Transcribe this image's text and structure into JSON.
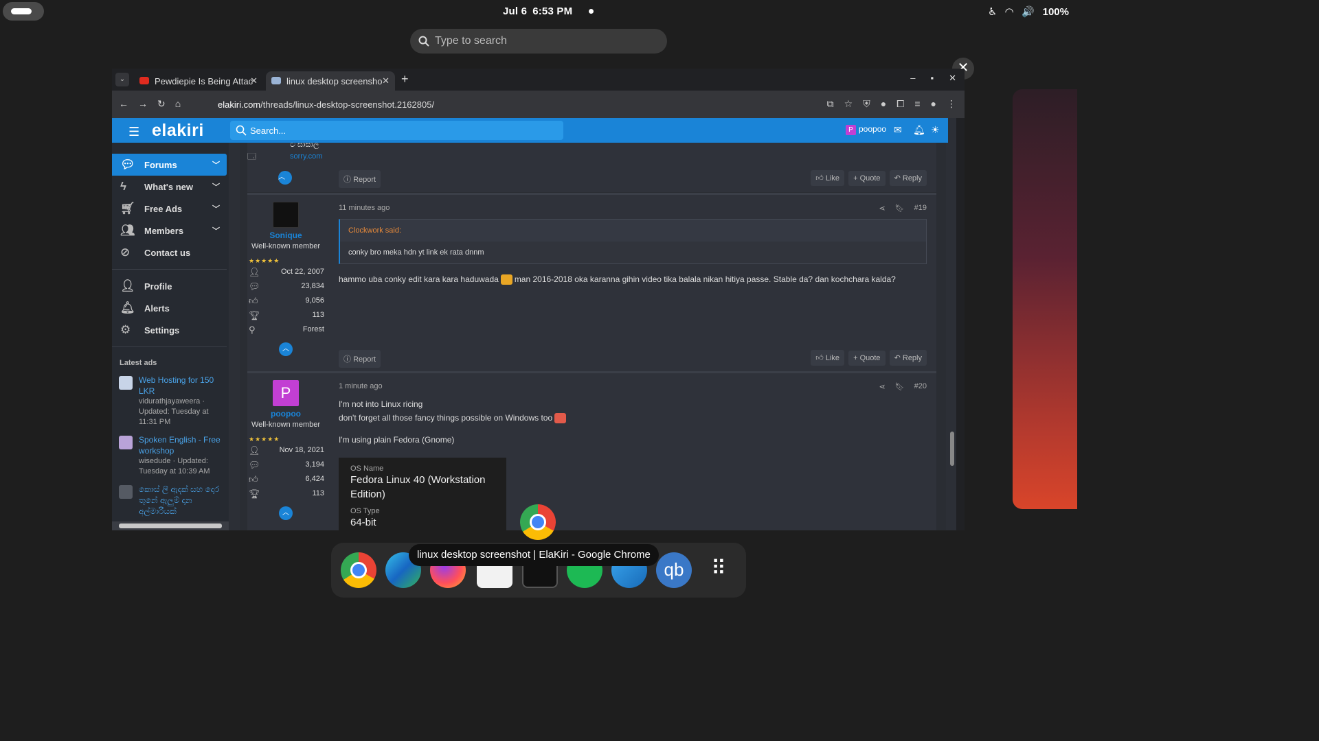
{
  "topbar": {
    "date": "Jul 6",
    "time": "6:53 PM",
    "battery": "100%"
  },
  "gnome_search": {
    "placeholder": "Type to search"
  },
  "browser": {
    "tabs": [
      {
        "label": "Pewdiepie Is Being Attac"
      },
      {
        "label": "linux desktop screensho"
      }
    ],
    "url_domain": "elakiri.com",
    "url_path": "/threads/linux-desktop-screenshot.2162805/"
  },
  "site": {
    "logo": "elakiri",
    "search_placeholder": "Search...",
    "username": "poopoo",
    "user_initial": "P",
    "nav": [
      {
        "label": "Forums"
      },
      {
        "label": "What's new"
      },
      {
        "label": "Free Ads"
      },
      {
        "label": "Members"
      },
      {
        "label": "Contact us"
      }
    ],
    "account": [
      {
        "label": "Profile"
      },
      {
        "label": "Alerts"
      },
      {
        "label": "Settings"
      }
    ],
    "latest_ads_heading": "Latest ads",
    "ads": [
      {
        "title": "Web Hosting for 150 LKR",
        "meta": "vidurathjayaweera · Updated: Tuesday at 11:31 PM"
      },
      {
        "title": "Spoken English - Free workshop",
        "meta": "wisedude · Updated: Tuesday at 10:39 AM"
      },
      {
        "title": "කොස් ලී ඇදක් සහ දොර තුනේ ඇලුම් දාන අල්මාරියක්",
        "meta": ""
      }
    ]
  },
  "prev_post": {
    "location_partial": "ට ඝාසාල",
    "website": "sorry.com",
    "report": "Report",
    "like": "Like",
    "quote": "Quote",
    "reply": "Reply"
  },
  "posts": [
    {
      "username": "Sonique",
      "title": "Well-known member",
      "stars": "★★★★★",
      "joined": "Oct 22, 2007",
      "messages": "23,834",
      "reactions": "9,056",
      "points": "113",
      "location": "Forest",
      "time": "11 minutes ago",
      "number": "#19",
      "quote_author": "Clockwork said:",
      "quote_text": "conky bro meka hdn yt link ek rata dnnm",
      "text_a": "hammo uba conky edit kara kara haduwada",
      "text_b": "man 2016-2018 oka karanna gihin video tika balala nikan hitiya passe. Stable da? dan kochchara kalda?",
      "report": "Report",
      "like": "Like",
      "quote": "Quote",
      "reply": "Reply"
    },
    {
      "username": "poopoo",
      "initial": "P",
      "title": "Well-known member",
      "stars": "★★★★★",
      "joined": "Nov 18, 2021",
      "messages": "3,194",
      "reactions": "6,424",
      "points": "113",
      "time": "1 minute ago",
      "number": "#20",
      "line1": "I'm not into Linux ricing",
      "line2": "don't forget all those fancy things possible on Windows too",
      "line3": "I'm using plain Fedora (Gnome)",
      "os_name_label": "OS Name",
      "os_name_value": "Fedora Linux 40 (Workstation Edition)",
      "os_type_label": "OS Type",
      "os_type_value": "64-bit"
    }
  ],
  "dock": {
    "tooltip": "linux desktop screenshot | ElaKiri - Google Chrome"
  },
  "colors": {
    "accent": "#1a84d7",
    "page_bg": "#2c2f36",
    "quote_author": "#e88a3a"
  }
}
